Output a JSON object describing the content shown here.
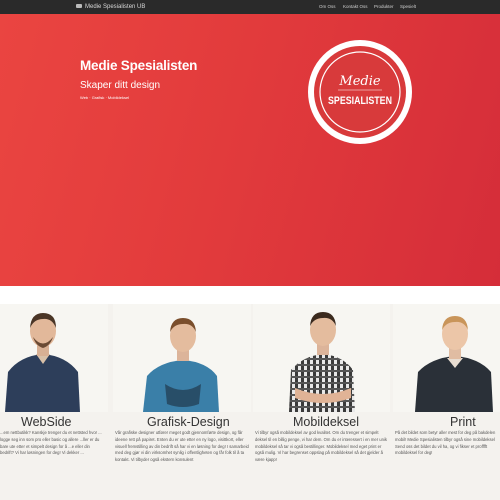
{
  "navbar": {
    "brand": "Medie Spesialisten UB",
    "brand_icon": "camera-icon",
    "links": [
      "Om Oss",
      "Kontakt Oss",
      "Produkter",
      "Spesielt"
    ]
  },
  "hero": {
    "title": "Medie Spesialisten",
    "subtitle": "Skaper ditt design",
    "tags": "Web · Grafisk · Mobildeksel",
    "logo_line1": "Medie",
    "logo_line2": "SPESIALISTEN"
  },
  "colors": {
    "hero_red": "#e23b3c",
    "navbar": "#2a2a2a",
    "page_bg": "#f4f2ee"
  },
  "cards": [
    {
      "title": "WebSide",
      "text": "...em nettbutikk? Kanskje trenger du et nettsted hvor ... logge seg inn som pro eller basic og allere ...ller er du bare ute etter et simpelt design for å ...e eller din bedrift? Vi har løsningen for deg! Vi dekker ..."
    },
    {
      "title": "Grafisk-Design",
      "text": "Vår grafiske designer utfører meget godt gjennomførte design, og får ideene rett på papiret. Enten du er ute etter en ny logo, visittkort, eller visuell fremstilling av din bedrift så har vi en løsning for deg! I samarbeid med deg gjør vi din virksomhet synlig i offentligheten og får folk til å ta kontakt. Vi tilbyder også ekstern konsulent"
    },
    {
      "title": "Mobildeksel",
      "text": "Vi tilbyr også mobildeksel av god kvalitet. Om du trenger et simpelt deksel til en billig penge, vi har dem. Om du er interessert i en mer unik mobildeksel så tar vi også bestillinger. Mobildeksel med eget print er også mulig. Vi har begrenset oppslag på mobildeksel så det gjelder å være kjapp!"
    },
    {
      "title": "Print",
      "text": "På det bildet som betyr aller mest for deg på bakdelen mobil! Medie Spesialisten tilbyr også sine mobildeksel Send oss det bildet du vil ha, og vi fikser et profffft mobildeksel for deg!"
    }
  ]
}
